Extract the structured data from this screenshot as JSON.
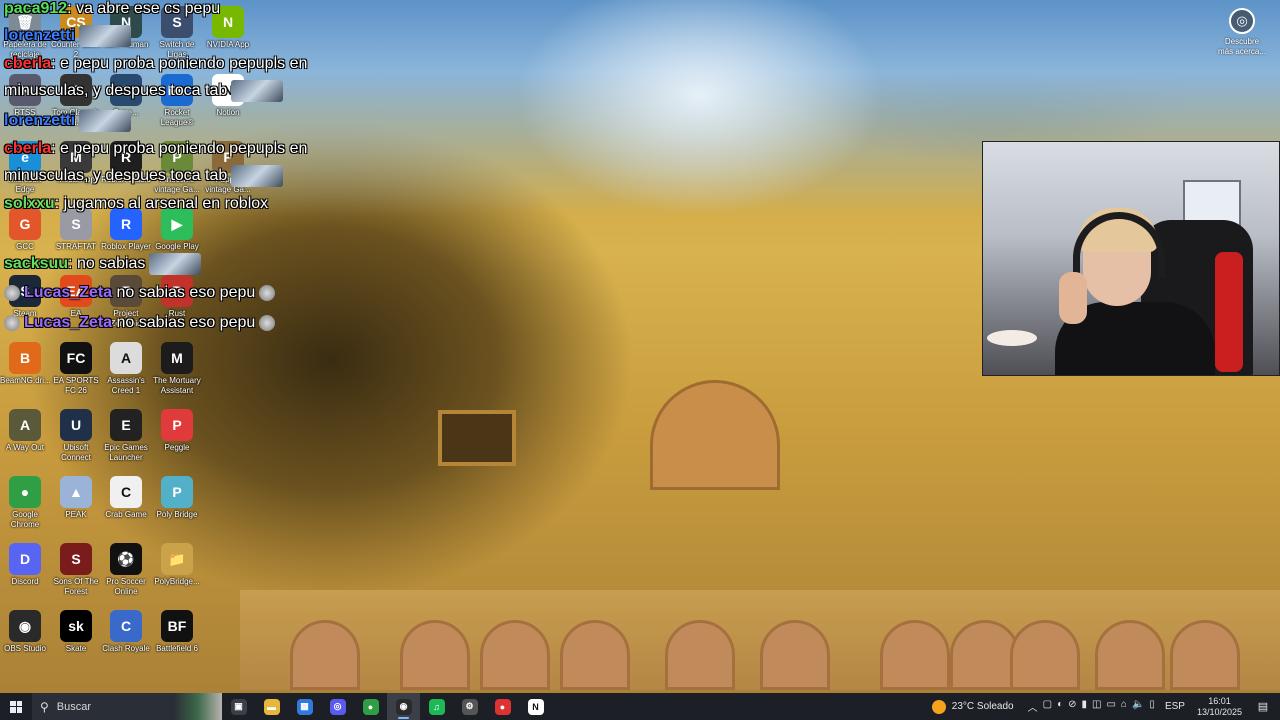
{
  "desktop_icons": [
    {
      "label": "Papelera de reciclaje",
      "color": "#7f8a96",
      "glyph": "🗑"
    },
    {
      "label": "Counter-Stri... 2",
      "color": "#c98a20",
      "glyph": "CS"
    },
    {
      "label": "No... Human",
      "color": "#2f4a4a",
      "glyph": "N"
    },
    {
      "label": "Switch de Ligas",
      "color": "#3c4e6e",
      "glyph": "S"
    },
    {
      "label": "NVIDIA App",
      "color": "#76b900",
      "glyph": "N"
    },
    {
      "label": "RTSS",
      "color": "#5a5a6e",
      "glyph": "R"
    },
    {
      "label": "Tom Clancy's Si...",
      "color": "#333",
      "glyph": "6"
    },
    {
      "label": "Supe...",
      "color": "#284a6e",
      "glyph": "S"
    },
    {
      "label": "Rocket League®",
      "color": "#1a6ad0",
      "glyph": "RL"
    },
    {
      "label": "Notion",
      "color": "#ffffff",
      "glyph": "N"
    },
    {
      "label": "Microsoft Edge",
      "color": "#1a8fd8",
      "glyph": "e"
    },
    {
      "label": "Medal App",
      "color": "#3a3a3a",
      "glyph": "M"
    },
    {
      "label": "Roblox Studio",
      "color": "#1f1f1f",
      "glyph": "R"
    },
    {
      "label": "Pinocchio vintage Ga...",
      "color": "#6a8a3a",
      "glyph": "P"
    },
    {
      "label": "Puppet vintage Ga...",
      "color": "#8a6a3a",
      "glyph": "P"
    },
    {
      "label": "GCC",
      "color": "#e2562a",
      "glyph": "G"
    },
    {
      "label": "STRAFTAT",
      "color": "#9a9aa4",
      "glyph": "S"
    },
    {
      "label": "Roblox Player",
      "color": "#2563ff",
      "glyph": "R"
    },
    {
      "label": "Google Play",
      "color": "#2dbd5a",
      "glyph": "▶"
    },
    {
      "label": "Steam",
      "color": "#1b2838",
      "glyph": "S"
    },
    {
      "label": "EA",
      "color": "#e24a1c",
      "glyph": "EA"
    },
    {
      "label": "Project Zomboid",
      "color": "#5a4a3a",
      "glyph": "Z"
    },
    {
      "label": "Rust",
      "color": "#c0322a",
      "glyph": "R"
    },
    {
      "label": "BeamNG.dri...",
      "color": "#e06a1a",
      "glyph": "B"
    },
    {
      "label": "EA SPORTS FC 26",
      "color": "#111",
      "glyph": "FC"
    },
    {
      "label": "Assassin's Creed 1",
      "color": "#dcdcdc",
      "glyph": "A"
    },
    {
      "label": "The Mortuary Assistant",
      "color": "#1c1c1c",
      "glyph": "M"
    },
    {
      "label": "A Way Out",
      "color": "#5a5a3a",
      "glyph": "A"
    },
    {
      "label": "Ubisoft Connect",
      "color": "#1f3048",
      "glyph": "U"
    },
    {
      "label": "Epic Games Launcher",
      "color": "#222",
      "glyph": "E"
    },
    {
      "label": "Peggle",
      "color": "#e03a3a",
      "glyph": "P"
    },
    {
      "label": "Google Chrome",
      "color": "#2f9e44",
      "glyph": "●"
    },
    {
      "label": "PEAK",
      "color": "#9ab3d6",
      "glyph": "▲"
    },
    {
      "label": "Crab Game",
      "color": "#f0f0f0",
      "glyph": "C"
    },
    {
      "label": "Poly Bridge",
      "color": "#52b0c9",
      "glyph": "P"
    },
    {
      "label": "Discord",
      "color": "#5865f2",
      "glyph": "D"
    },
    {
      "label": "Sons Of The Forest",
      "color": "#7a1c1c",
      "glyph": "S"
    },
    {
      "label": "Pro Soccer Online",
      "color": "#111",
      "glyph": "⚽"
    },
    {
      "label": "PolyBridge...",
      "color": "#c9a24a",
      "glyph": "📁"
    },
    {
      "label": "OBS Studio",
      "color": "#2a2a2a",
      "glyph": "◉"
    },
    {
      "label": "Skate",
      "color": "#000",
      "glyph": "sk"
    },
    {
      "label": "Clash Royale",
      "color": "#3a6ac9",
      "glyph": "C"
    },
    {
      "label": "Battlefield 6",
      "color": "#111",
      "glyph": "BF"
    }
  ],
  "chat": [
    {
      "user": "paca912",
      "user_color": "#55e05a",
      "text": ": va abre ese cs pepu",
      "emote": false
    },
    {
      "user": "lorenzetti",
      "user_color": "#3a7bff",
      "text": "",
      "emote": true
    },
    {
      "user": "cberla",
      "user_color": "#ff3030",
      "text": ": e pepu proba poniendo pepupls en",
      "emote": false
    },
    {
      "user": "",
      "user_color": "#ffffff",
      "text": "minusculas, y despues toca tab",
      "emote": true
    },
    {
      "user": "lorenzetti",
      "user_color": "#3a7bff",
      "text": "",
      "emote": true
    },
    {
      "user": "cberla",
      "user_color": "#ff3030",
      "text": ": e pepu proba poniendo pepupls en",
      "emote": false
    },
    {
      "user": "",
      "user_color": "#ffffff",
      "text": "minusculas, y despues toca tab",
      "emote": true
    },
    {
      "user": "solxxu",
      "user_color": "#66e060",
      "text": ": jugamos al arsenal en roblox",
      "emote": false
    },
    {
      "user": "sacksuu",
      "user_color": "#66e060",
      "text": ": no sabias",
      "emote": true
    },
    {
      "user": "Lucas_Zeta",
      "user_color": "#9a6bff",
      "text": " no sabias eso pepu",
      "emote": true
    },
    {
      "user": "Lucas_Zeta",
      "user_color": "#9a6bff",
      "text": " no sabias eso pepu",
      "emote": true
    }
  ],
  "discover": {
    "label": "Descubre más acerca..."
  },
  "taskbar": {
    "search_placeholder": "Buscar",
    "apps": [
      {
        "name": "task-view",
        "color": "#3a3f48",
        "glyph": "▣"
      },
      {
        "name": "file-explorer",
        "color": "#e8b63a",
        "glyph": "▬"
      },
      {
        "name": "store",
        "color": "#2f7ae0",
        "glyph": "▦"
      },
      {
        "name": "medal",
        "color": "#5a5af0",
        "glyph": "◎"
      },
      {
        "name": "chrome",
        "color": "#2f9e44",
        "glyph": "●"
      },
      {
        "name": "obs",
        "color": "#2a2a2a",
        "glyph": "◉"
      },
      {
        "name": "spotify",
        "color": "#1db954",
        "glyph": "♫"
      },
      {
        "name": "settings",
        "color": "#555",
        "glyph": "⚙"
      },
      {
        "name": "unknown-red",
        "color": "#d33",
        "glyph": "●"
      },
      {
        "name": "notion",
        "color": "#fff",
        "glyph": "N"
      }
    ],
    "weather": "23°C  Soleado",
    "language": "ESP",
    "time": "16:01",
    "date": "13/10/2025"
  }
}
